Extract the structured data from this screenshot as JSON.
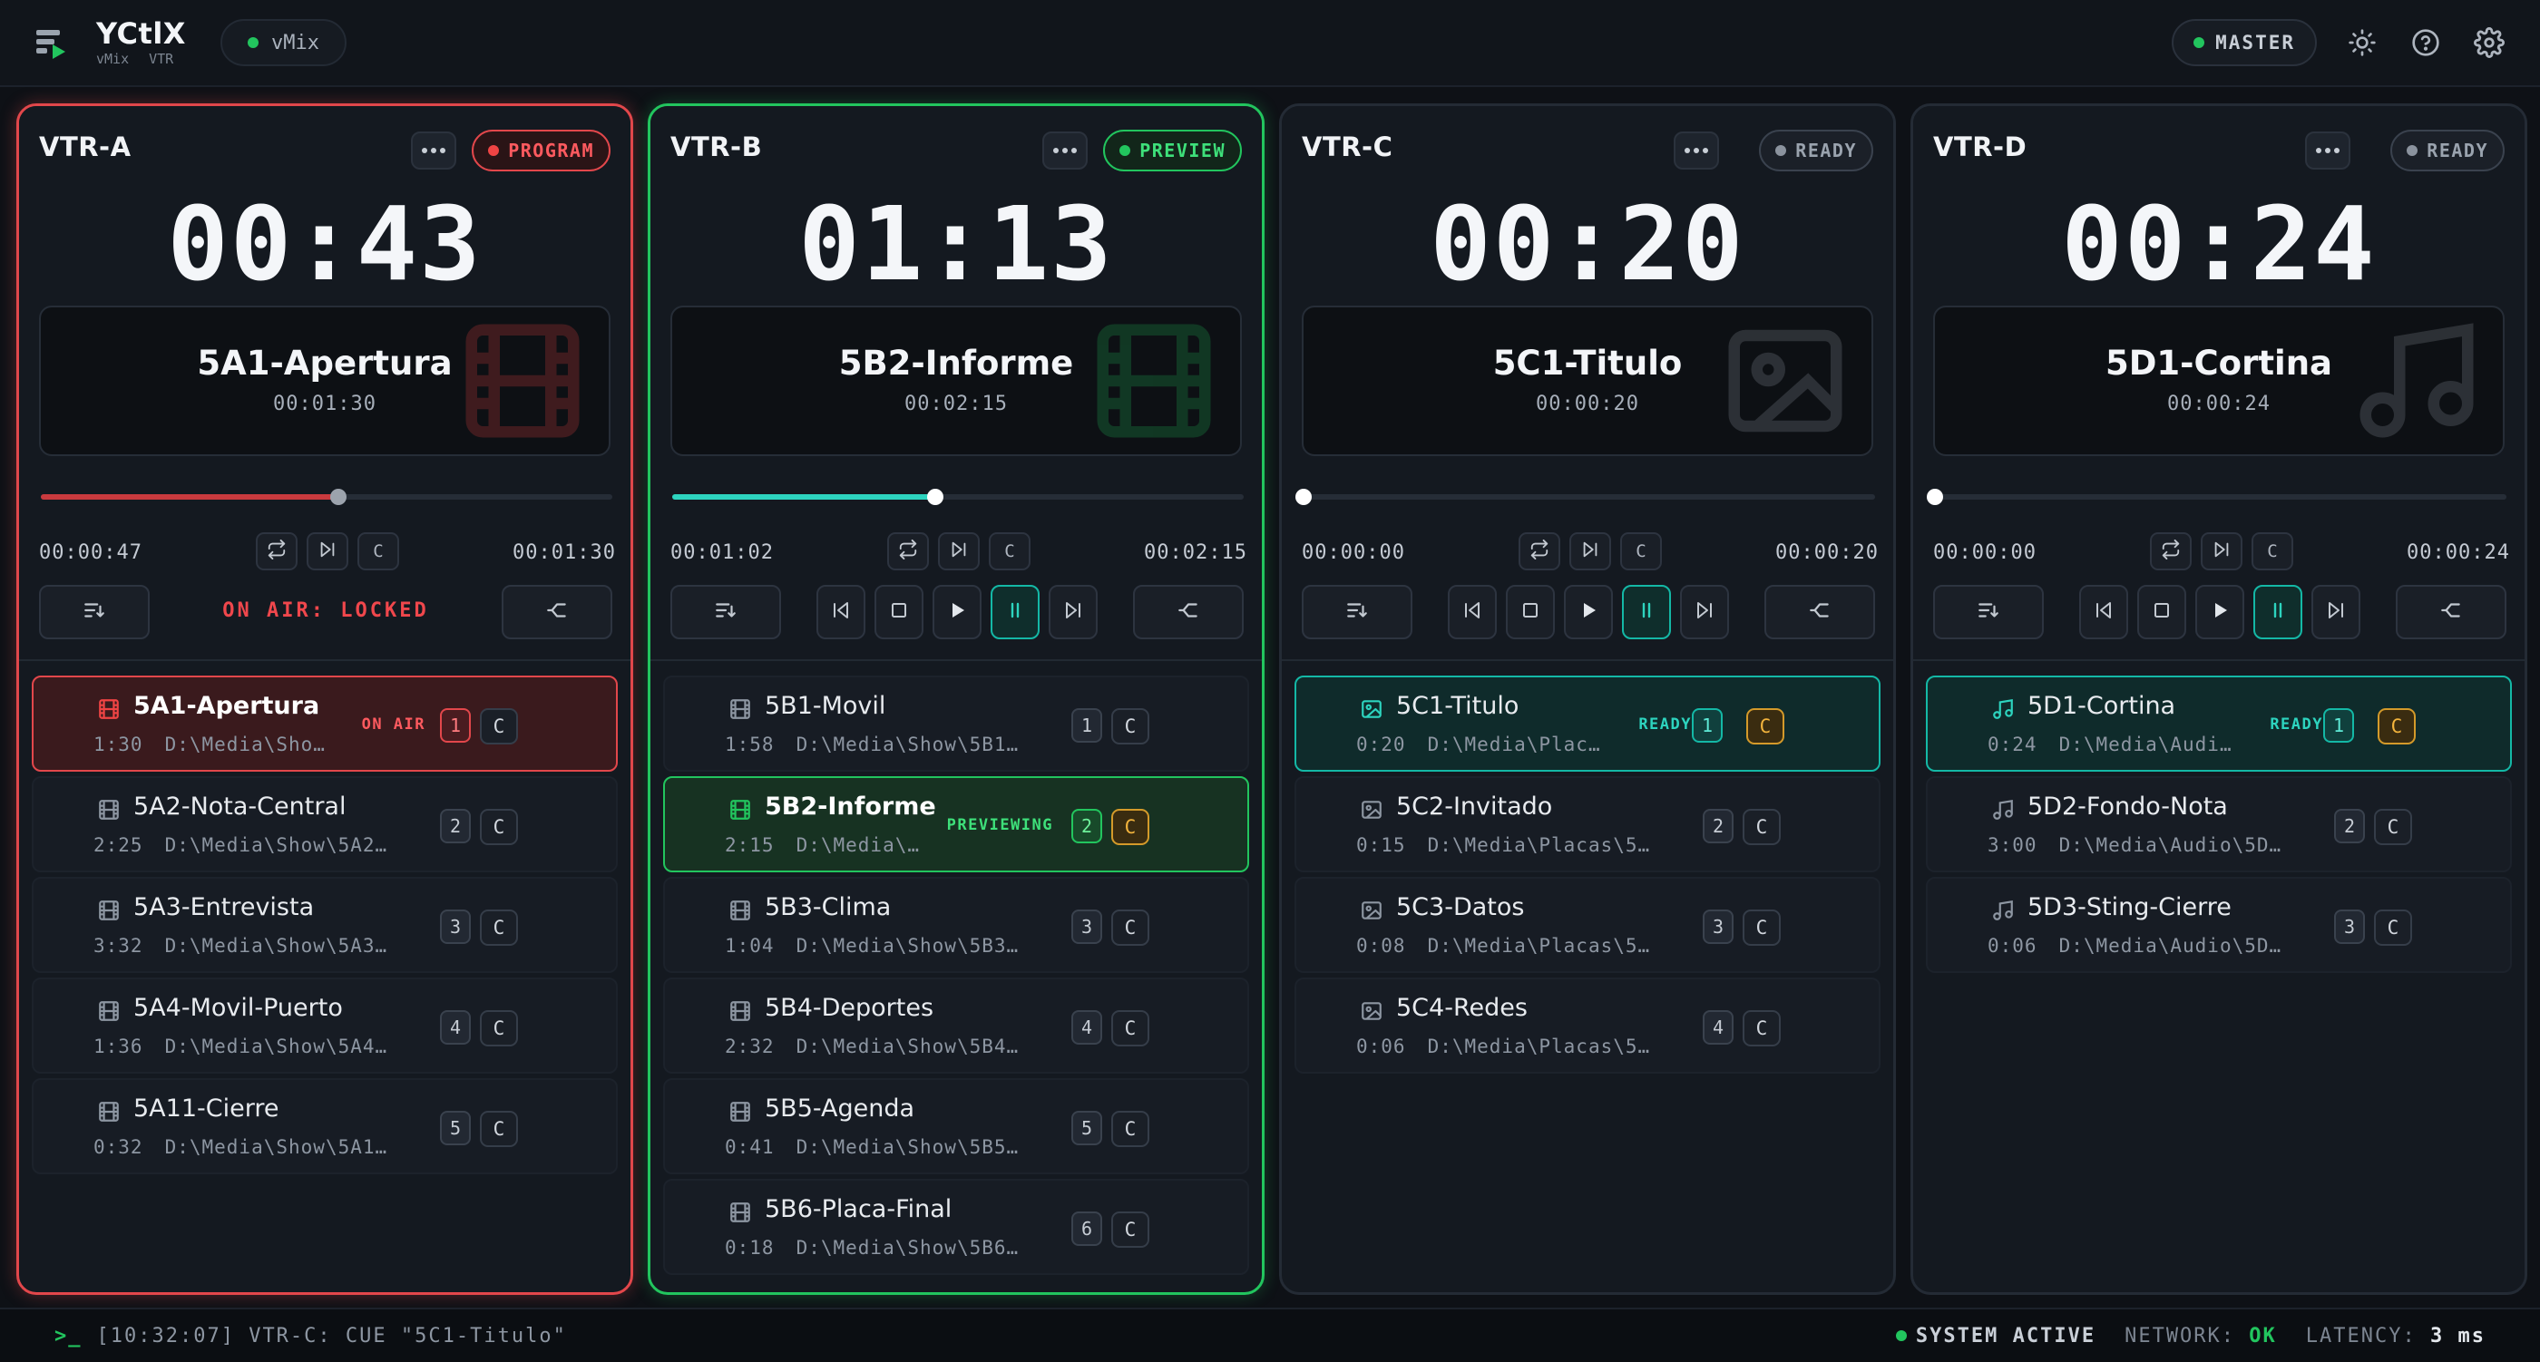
{
  "header": {
    "brand": "YCtlX",
    "brand_sub": [
      "vMix",
      "VTR"
    ],
    "connection_label": "vMix",
    "master_label": "MASTER"
  },
  "colors": {
    "program": "#e2474b",
    "preview": "#22c55e",
    "ready": "#14b8a6",
    "cue": "#d49a2a"
  },
  "vtrs": [
    {
      "name": "VTR-A",
      "state": "program",
      "status": "PROGRAM",
      "timer": "00:43",
      "clip_name": "5A1-Apertura",
      "clip_duration": "00:01:30",
      "elapsed": "00:00:47",
      "total": "00:01:30",
      "progress": 0.52,
      "locked_text": "ON AIR: LOCKED",
      "media_icon": "video-icon",
      "items": [
        {
          "name": "5A1-Apertura",
          "duration": "1:30",
          "path": "D:\\Media\\Sho…",
          "num": "1",
          "cue": "C",
          "tag": "ON AIR",
          "state": "program"
        },
        {
          "name": "5A2-Nota-Central",
          "duration": "2:25",
          "path": "D:\\Media\\Show\\5A2…",
          "num": "2",
          "cue": "C",
          "tag": "",
          "state": ""
        },
        {
          "name": "5A3-Entrevista",
          "duration": "3:32",
          "path": "D:\\Media\\Show\\5A3…",
          "num": "3",
          "cue": "C",
          "tag": "",
          "state": ""
        },
        {
          "name": "5A4-Movil-Puerto",
          "duration": "1:36",
          "path": "D:\\Media\\Show\\5A4…",
          "num": "4",
          "cue": "C",
          "tag": "",
          "state": ""
        },
        {
          "name": "5A11-Cierre",
          "duration": "0:32",
          "path": "D:\\Media\\Show\\5A1…",
          "num": "5",
          "cue": "C",
          "tag": "",
          "state": ""
        }
      ]
    },
    {
      "name": "VTR-B",
      "state": "preview",
      "status": "PREVIEW",
      "timer": "01:13",
      "clip_name": "5B2-Informe",
      "clip_duration": "00:02:15",
      "elapsed": "00:01:02",
      "total": "00:02:15",
      "progress": 0.46,
      "media_icon": "video-icon",
      "items": [
        {
          "name": "5B1-Movil",
          "duration": "1:58",
          "path": "D:\\Media\\Show\\5B1…",
          "num": "1",
          "cue": "C",
          "tag": "",
          "state": ""
        },
        {
          "name": "5B2-Informe",
          "duration": "2:15",
          "path": "D:\\Media\\…",
          "num": "2",
          "cue": "C",
          "tag": "PREVIEWING",
          "state": "preview"
        },
        {
          "name": "5B3-Clima",
          "duration": "1:04",
          "path": "D:\\Media\\Show\\5B3…",
          "num": "3",
          "cue": "C",
          "tag": "",
          "state": ""
        },
        {
          "name": "5B4-Deportes",
          "duration": "2:32",
          "path": "D:\\Media\\Show\\5B4…",
          "num": "4",
          "cue": "C",
          "tag": "",
          "state": ""
        },
        {
          "name": "5B5-Agenda",
          "duration": "0:41",
          "path": "D:\\Media\\Show\\5B5…",
          "num": "5",
          "cue": "C",
          "tag": "",
          "state": ""
        },
        {
          "name": "5B6-Placa-Final",
          "duration": "0:18",
          "path": "D:\\Media\\Show\\5B6…",
          "num": "6",
          "cue": "C",
          "tag": "",
          "state": ""
        }
      ]
    },
    {
      "name": "VTR-C",
      "state": "ready",
      "status": "READY",
      "timer": "00:20",
      "clip_name": "5C1-Titulo",
      "clip_duration": "00:00:20",
      "elapsed": "00:00:00",
      "total": "00:00:20",
      "progress": 0,
      "media_icon": "image-icon",
      "items": [
        {
          "name": "5C1-Titulo",
          "duration": "0:20",
          "path": "D:\\Media\\Plac…",
          "num": "1",
          "cue": "C",
          "tag": "READY",
          "state": "ready"
        },
        {
          "name": "5C2-Invitado",
          "duration": "0:15",
          "path": "D:\\Media\\Placas\\5…",
          "num": "2",
          "cue": "C",
          "tag": "",
          "state": ""
        },
        {
          "name": "5C3-Datos",
          "duration": "0:08",
          "path": "D:\\Media\\Placas\\5…",
          "num": "3",
          "cue": "C",
          "tag": "",
          "state": ""
        },
        {
          "name": "5C4-Redes",
          "duration": "0:06",
          "path": "D:\\Media\\Placas\\5…",
          "num": "4",
          "cue": "C",
          "tag": "",
          "state": ""
        }
      ]
    },
    {
      "name": "VTR-D",
      "state": "ready",
      "status": "READY",
      "timer": "00:24",
      "clip_name": "5D1-Cortina",
      "clip_duration": "00:00:24",
      "elapsed": "00:00:00",
      "total": "00:00:24",
      "progress": 0,
      "media_icon": "music-icon",
      "items": [
        {
          "name": "5D1-Cortina",
          "duration": "0:24",
          "path": "D:\\Media\\Audi…",
          "num": "1",
          "cue": "C",
          "tag": "READY",
          "state": "ready"
        },
        {
          "name": "5D2-Fondo-Nota",
          "duration": "3:00",
          "path": "D:\\Media\\Audio\\5D…",
          "num": "2",
          "cue": "C",
          "tag": "",
          "state": ""
        },
        {
          "name": "5D3-Sting-Cierre",
          "duration": "0:06",
          "path": "D:\\Media\\Audio\\5D…",
          "num": "3",
          "cue": "C",
          "tag": "",
          "state": ""
        }
      ]
    }
  ],
  "mini_cue_label": "C",
  "statusbar": {
    "log": "[10:32:07] VTR-C: CUE \"5C1-Titulo\"",
    "system": "SYSTEM ACTIVE",
    "network_label": "NETWORK:",
    "network_value": "OK",
    "latency_label": "LATENCY:",
    "latency_value": "3 ms"
  }
}
